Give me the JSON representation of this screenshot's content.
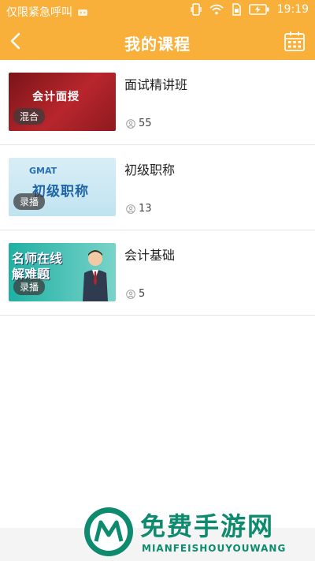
{
  "status": {
    "carrier_text": "仅限紧急呼叫",
    "time": "19:19"
  },
  "header": {
    "title": "我的课程"
  },
  "courses": [
    {
      "title": "面试精讲班",
      "badge": "混合",
      "learners": "55",
      "thumb_text": "会计面授"
    },
    {
      "title": "初级职称",
      "badge": "录播",
      "learners": "13",
      "thumb_gmat": "GMAT",
      "thumb_text": "初级职称"
    },
    {
      "title": "会计基础",
      "badge": "录播",
      "learners": "5",
      "thumb_text_1": "名师在线",
      "thumb_text_2": "解难题"
    }
  ],
  "watermark": {
    "title": "免费手游网",
    "sub": "MIANFEISHOUYOUWANG"
  },
  "colors": {
    "accent": "#f8b03a",
    "watermark": "#0e8a6f"
  }
}
